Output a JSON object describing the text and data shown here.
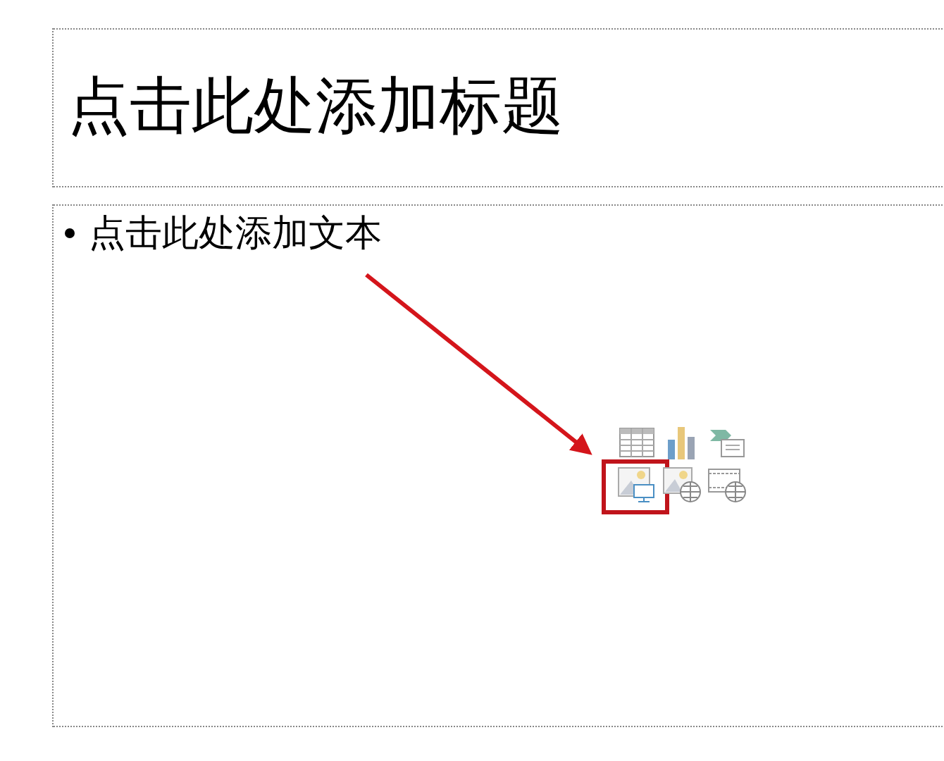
{
  "title_placeholder": {
    "text": "点击此处添加标题"
  },
  "body_placeholder": {
    "bullets": [
      "点击此处添加文本"
    ],
    "insert_icons": [
      {
        "kind": "table",
        "highlighted": false
      },
      {
        "kind": "chart",
        "highlighted": false
      },
      {
        "kind": "smartart",
        "highlighted": false
      },
      {
        "kind": "picture",
        "highlighted": true
      },
      {
        "kind": "online-picture",
        "highlighted": false
      },
      {
        "kind": "video",
        "highlighted": false
      }
    ]
  }
}
